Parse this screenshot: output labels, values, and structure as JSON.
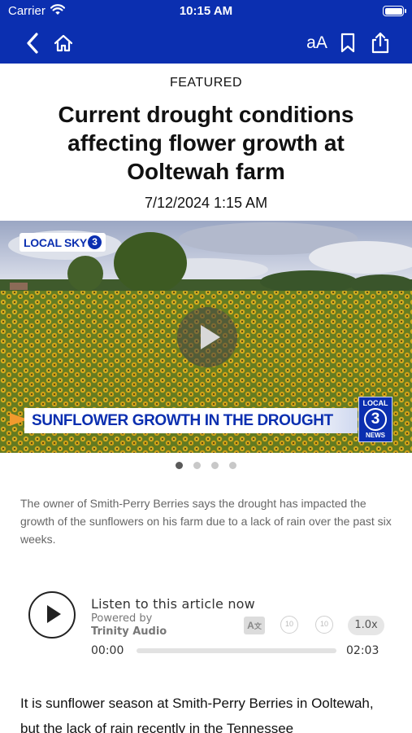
{
  "status_bar": {
    "carrier": "Carrier",
    "time": "10:15 AM"
  },
  "nav": {
    "back_icon": "chevron-left-icon",
    "home_icon": "home-icon",
    "font_size_label": "aA",
    "bookmark_icon": "bookmark-icon",
    "share_icon": "share-icon",
    "bar_color": "#0b2fb0"
  },
  "article": {
    "category": "FEATURED",
    "headline": "Current drought conditions affecting flower growth at Ooltewah farm",
    "date": "7/12/2024 1:15 AM",
    "media": {
      "sky_logo_text": "LOCAL SKY",
      "sky_logo_number": "3",
      "lower_third": "SUNFLOWER GROWTH IN THE DROUGHT",
      "badge_top": "LOCAL",
      "badge_number": "3",
      "badge_bottom": "NEWS"
    },
    "carousel": {
      "count": 4,
      "active_index": 0
    },
    "caption": "The owner of Smith-Perry Berries says the drought has impacted the growth of the sunflowers on his farm due to a lack of rain over the past six weeks.",
    "audio": {
      "title": "Listen to this article now",
      "powered_by": "Powered by",
      "brand": "Trinity Audio",
      "translate_icon": "translate-icon",
      "skip_back_label": "10",
      "skip_forward_label": "10",
      "speed": "1.0x",
      "current_time": "00:00",
      "total_time": "02:03",
      "progress_fraction": 0
    },
    "body": "It is sunflower season at Smith-Perry Berries in Ooltewah, but the lack of rain recently in the Tennessee"
  }
}
